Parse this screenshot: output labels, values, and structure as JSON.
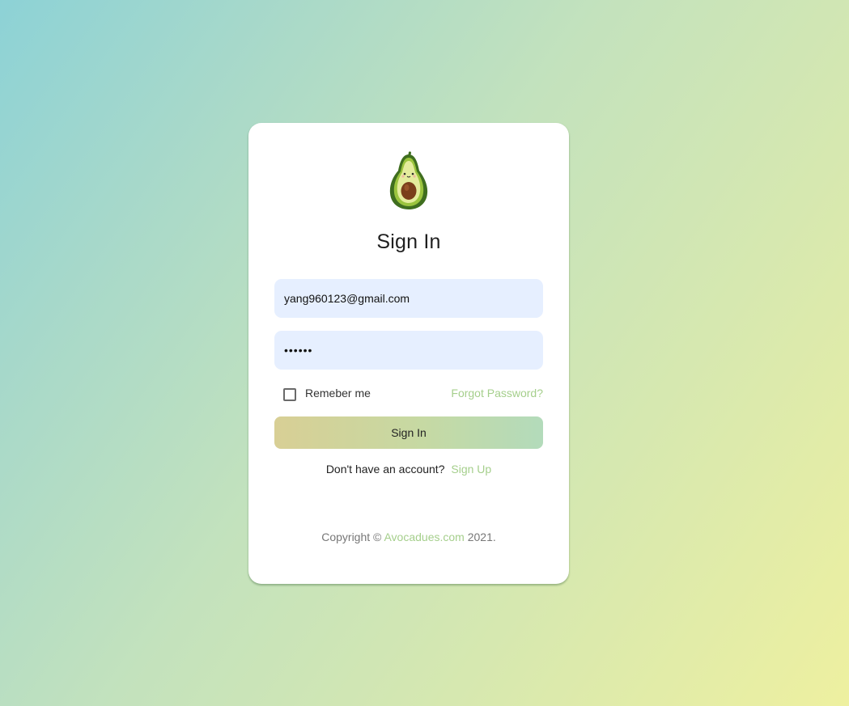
{
  "logo": {
    "icon": "avocado-mascot-icon"
  },
  "form": {
    "title": "Sign In",
    "email_value": "yang960123@gmail.com",
    "password_value": "••••••",
    "remember_label": "Remeber me",
    "remember_checked": false,
    "forgot_label": "Forgot Password?",
    "submit_label": "Sign In",
    "signup_prompt": "Don't have an account?",
    "signup_label": "Sign Up"
  },
  "footer": {
    "prefix": "Copyright ©",
    "brand": "Avocadues.com",
    "suffix": "2021."
  },
  "colors": {
    "accent_link": "#a5cf8c",
    "input_bg": "#e6efff",
    "card_bg": "#ffffff"
  }
}
